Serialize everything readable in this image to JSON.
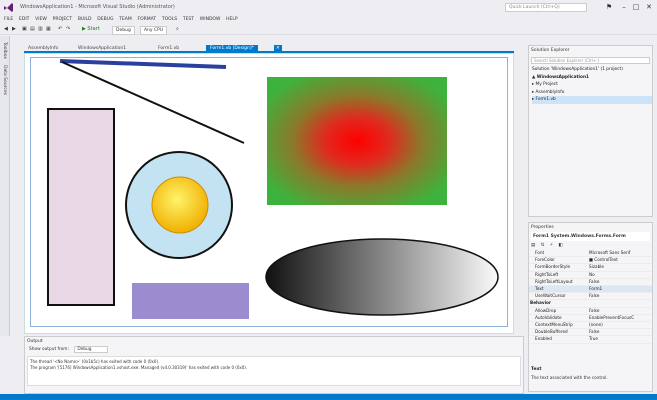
{
  "window": {
    "title": "WindowsApplication1 - Microsoft Visual Studio (Administrator)",
    "quick_launch_placeholder": "Quick Launch (Ctrl+Q)"
  },
  "menu": [
    "FILE",
    "EDIT",
    "VIEW",
    "PROJECT",
    "BUILD",
    "DEBUG",
    "TEAM",
    "FORMAT",
    "TOOLS",
    "TEST",
    "WINDOW",
    "HELP"
  ],
  "toolbar": {
    "start_label": "▶ Start",
    "config": "Debug",
    "platform": "Any CPU"
  },
  "left_tabs": [
    "Toolbox",
    "Data Sources"
  ],
  "doc_tabs": [
    "AssemblyInfo",
    "WindowsApplication1",
    "Form1.vb",
    "Form1.vb [Design]*"
  ],
  "solution_explorer": {
    "title": "Solution Explorer",
    "search_placeholder": "Search Solution Explorer (Ctrl+;)",
    "tree": [
      "Solution 'WindowsApplication1' (1 project)",
      "▲ WindowsApplication1",
      "   ▸ My Project",
      "   ▸ AssemblyInfo",
      "   ▸ Form1.vb"
    ]
  },
  "properties": {
    "title": "Properties",
    "object": "Form1  System.Windows.Forms.Form",
    "rows": [
      {
        "k": "Font",
        "v": "Microsoft Sans Serif",
        "cat": false
      },
      {
        "k": "ForeColor",
        "v": "■ ControlText",
        "cat": false
      },
      {
        "k": "FormBorderStyle",
        "v": "Sizable",
        "cat": false
      },
      {
        "k": "RightToLeft",
        "v": "No",
        "cat": false
      },
      {
        "k": "RightToLeftLayout",
        "v": "False",
        "cat": false
      },
      {
        "k": "Text",
        "v": "Form1",
        "cat": false
      },
      {
        "k": "UseWaitCursor",
        "v": "False",
        "cat": false
      },
      {
        "k": "Behavior",
        "v": "",
        "cat": true
      },
      {
        "k": "AllowDrop",
        "v": "False",
        "cat": false
      },
      {
        "k": "AutoValidate",
        "v": "EnablePreventFocusC",
        "cat": false
      },
      {
        "k": "ContextMenuStrip",
        "v": "(none)",
        "cat": false
      },
      {
        "k": "DoubleBuffered",
        "v": "False",
        "cat": false
      },
      {
        "k": "Enabled",
        "v": "True",
        "cat": false
      }
    ],
    "desc_title": "Text",
    "desc_body": "The text associated with the control."
  },
  "output": {
    "title": "Output",
    "show_from_label": "Show output from:",
    "show_from_value": "Debug",
    "lines": [
      "The thread '<No Name>' (0x1b5c) has exited with code 0 (0x0).",
      "The program '[5176] WindowsApplication1.vshost.exe: Managed (v4.0.30319)' has exited with code 0 (0x0)."
    ]
  },
  "colors": {
    "accent": "#007acc",
    "rect_fill": "#e8d7e4",
    "ellipse_fill": "#c4e3f2",
    "sun": "#f5c400",
    "purple": "#9b8ccf",
    "green": "#3db33d",
    "red": "#ff0000",
    "line_blue": "#2b3f9c"
  }
}
